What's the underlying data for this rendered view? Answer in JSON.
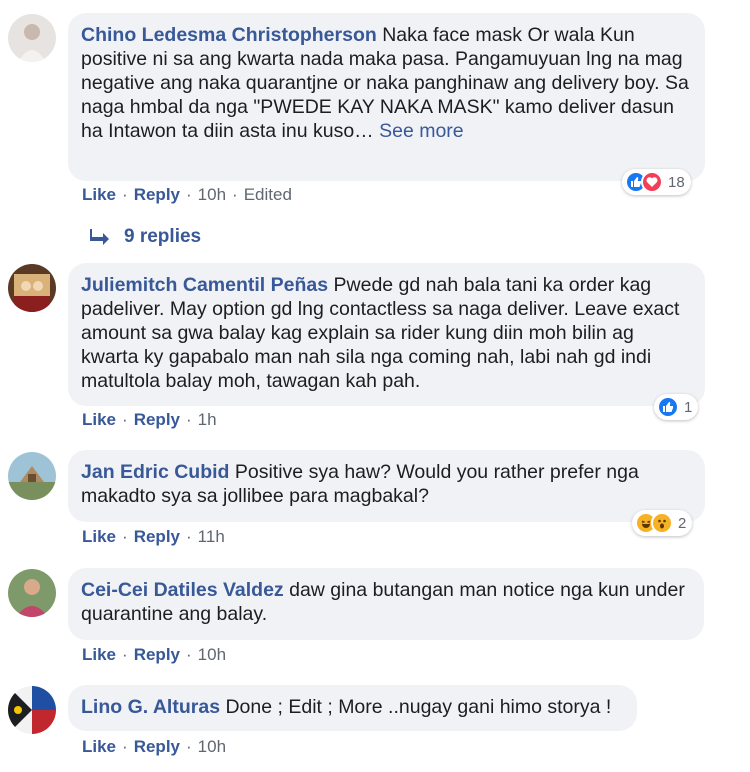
{
  "comments": [
    {
      "author": "Chino Ledesma Christopherson",
      "text": "Naka face mask Or wala Kun positive ni sa ang kwarta nada maka pasa. Pangamuyuan lng na mag negative ang naka quarantjne or naka panghinaw ang delivery boy. Sa naga hmbal da nga \"PWEDE KAY NAKA MASK\" kamo deliver dasun ha Intawon ta diin asta inu kuso…",
      "see_more": "See more",
      "like": "Like",
      "reply": "Reply",
      "time": "10h",
      "edited": "Edited",
      "reaction_count": "18",
      "reactions": [
        "like-icon",
        "love-icon"
      ],
      "replies_label": "9 replies"
    },
    {
      "author": "Juliemitch Camentil Peñas",
      "text": "Pwede gd nah bala tani ka order kag padeliver. May option gd lng contactless sa naga deliver. Leave exact amount sa gwa balay kag explain sa rider kung diin moh bilin ag kwarta ky gapabalo man nah sila nga coming nah, labi nah gd indi matultola balay moh, tawagan kah pah.",
      "like": "Like",
      "reply": "Reply",
      "time": "1h",
      "reaction_count": "1",
      "reactions": [
        "like-icon"
      ]
    },
    {
      "author": "Jan Edric Cubid",
      "text": "Positive sya haw? Would you rather prefer nga makadto sya sa jollibee para magbakal?",
      "like": "Like",
      "reply": "Reply",
      "time": "11h",
      "reaction_count": "2",
      "reactions": [
        "haha-icon",
        "wow-icon"
      ]
    },
    {
      "author": "Cei-Cei Datiles Valdez",
      "text": "daw gina butangan man notice nga kun under quarantine ang balay.",
      "like": "Like",
      "reply": "Reply",
      "time": "10h"
    },
    {
      "author": "Lino G. Alturas",
      "text": "Done ; Edit ; More ..nugay gani himo storya !",
      "like": "Like",
      "reply": "Reply",
      "time": "10h"
    }
  ],
  "colors": {
    "bubble": "#f0f2f5",
    "link": "#385898",
    "meta": "#606770",
    "like": "#1877f2",
    "love": "#f33e58",
    "haha": "#f7b125"
  }
}
